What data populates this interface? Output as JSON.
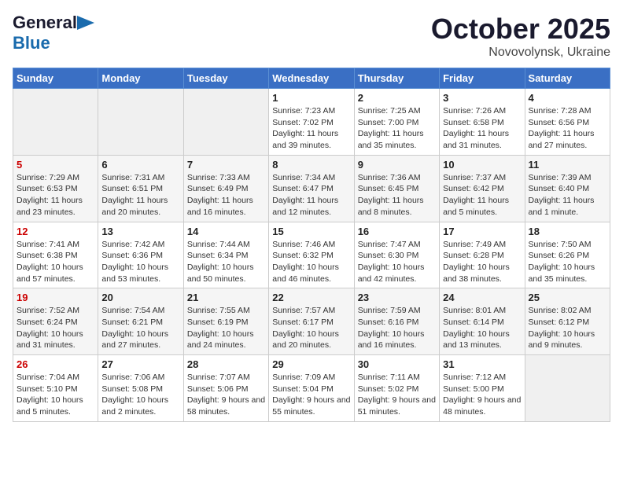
{
  "logo": {
    "part1": "General",
    "part2": "Blue"
  },
  "title": "October 2025",
  "location": "Novovolynsk, Ukraine",
  "weekdays": [
    "Sunday",
    "Monday",
    "Tuesday",
    "Wednesday",
    "Thursday",
    "Friday",
    "Saturday"
  ],
  "weeks": [
    [
      {
        "day": "",
        "info": ""
      },
      {
        "day": "",
        "info": ""
      },
      {
        "day": "",
        "info": ""
      },
      {
        "day": "1",
        "info": "Sunrise: 7:23 AM\nSunset: 7:02 PM\nDaylight: 11 hours and 39 minutes."
      },
      {
        "day": "2",
        "info": "Sunrise: 7:25 AM\nSunset: 7:00 PM\nDaylight: 11 hours and 35 minutes."
      },
      {
        "day": "3",
        "info": "Sunrise: 7:26 AM\nSunset: 6:58 PM\nDaylight: 11 hours and 31 minutes."
      },
      {
        "day": "4",
        "info": "Sunrise: 7:28 AM\nSunset: 6:56 PM\nDaylight: 11 hours and 27 minutes."
      }
    ],
    [
      {
        "day": "5",
        "info": "Sunrise: 7:29 AM\nSunset: 6:53 PM\nDaylight: 11 hours and 23 minutes."
      },
      {
        "day": "6",
        "info": "Sunrise: 7:31 AM\nSunset: 6:51 PM\nDaylight: 11 hours and 20 minutes."
      },
      {
        "day": "7",
        "info": "Sunrise: 7:33 AM\nSunset: 6:49 PM\nDaylight: 11 hours and 16 minutes."
      },
      {
        "day": "8",
        "info": "Sunrise: 7:34 AM\nSunset: 6:47 PM\nDaylight: 11 hours and 12 minutes."
      },
      {
        "day": "9",
        "info": "Sunrise: 7:36 AM\nSunset: 6:45 PM\nDaylight: 11 hours and 8 minutes."
      },
      {
        "day": "10",
        "info": "Sunrise: 7:37 AM\nSunset: 6:42 PM\nDaylight: 11 hours and 5 minutes."
      },
      {
        "day": "11",
        "info": "Sunrise: 7:39 AM\nSunset: 6:40 PM\nDaylight: 11 hours and 1 minute."
      }
    ],
    [
      {
        "day": "12",
        "info": "Sunrise: 7:41 AM\nSunset: 6:38 PM\nDaylight: 10 hours and 57 minutes."
      },
      {
        "day": "13",
        "info": "Sunrise: 7:42 AM\nSunset: 6:36 PM\nDaylight: 10 hours and 53 minutes."
      },
      {
        "day": "14",
        "info": "Sunrise: 7:44 AM\nSunset: 6:34 PM\nDaylight: 10 hours and 50 minutes."
      },
      {
        "day": "15",
        "info": "Sunrise: 7:46 AM\nSunset: 6:32 PM\nDaylight: 10 hours and 46 minutes."
      },
      {
        "day": "16",
        "info": "Sunrise: 7:47 AM\nSunset: 6:30 PM\nDaylight: 10 hours and 42 minutes."
      },
      {
        "day": "17",
        "info": "Sunrise: 7:49 AM\nSunset: 6:28 PM\nDaylight: 10 hours and 38 minutes."
      },
      {
        "day": "18",
        "info": "Sunrise: 7:50 AM\nSunset: 6:26 PM\nDaylight: 10 hours and 35 minutes."
      }
    ],
    [
      {
        "day": "19",
        "info": "Sunrise: 7:52 AM\nSunset: 6:24 PM\nDaylight: 10 hours and 31 minutes."
      },
      {
        "day": "20",
        "info": "Sunrise: 7:54 AM\nSunset: 6:21 PM\nDaylight: 10 hours and 27 minutes."
      },
      {
        "day": "21",
        "info": "Sunrise: 7:55 AM\nSunset: 6:19 PM\nDaylight: 10 hours and 24 minutes."
      },
      {
        "day": "22",
        "info": "Sunrise: 7:57 AM\nSunset: 6:17 PM\nDaylight: 10 hours and 20 minutes."
      },
      {
        "day": "23",
        "info": "Sunrise: 7:59 AM\nSunset: 6:16 PM\nDaylight: 10 hours and 16 minutes."
      },
      {
        "day": "24",
        "info": "Sunrise: 8:01 AM\nSunset: 6:14 PM\nDaylight: 10 hours and 13 minutes."
      },
      {
        "day": "25",
        "info": "Sunrise: 8:02 AM\nSunset: 6:12 PM\nDaylight: 10 hours and 9 minutes."
      }
    ],
    [
      {
        "day": "26",
        "info": "Sunrise: 7:04 AM\nSunset: 5:10 PM\nDaylight: 10 hours and 5 minutes."
      },
      {
        "day": "27",
        "info": "Sunrise: 7:06 AM\nSunset: 5:08 PM\nDaylight: 10 hours and 2 minutes."
      },
      {
        "day": "28",
        "info": "Sunrise: 7:07 AM\nSunset: 5:06 PM\nDaylight: 9 hours and 58 minutes."
      },
      {
        "day": "29",
        "info": "Sunrise: 7:09 AM\nSunset: 5:04 PM\nDaylight: 9 hours and 55 minutes."
      },
      {
        "day": "30",
        "info": "Sunrise: 7:11 AM\nSunset: 5:02 PM\nDaylight: 9 hours and 51 minutes."
      },
      {
        "day": "31",
        "info": "Sunrise: 7:12 AM\nSunset: 5:00 PM\nDaylight: 9 hours and 48 minutes."
      },
      {
        "day": "",
        "info": ""
      }
    ]
  ]
}
